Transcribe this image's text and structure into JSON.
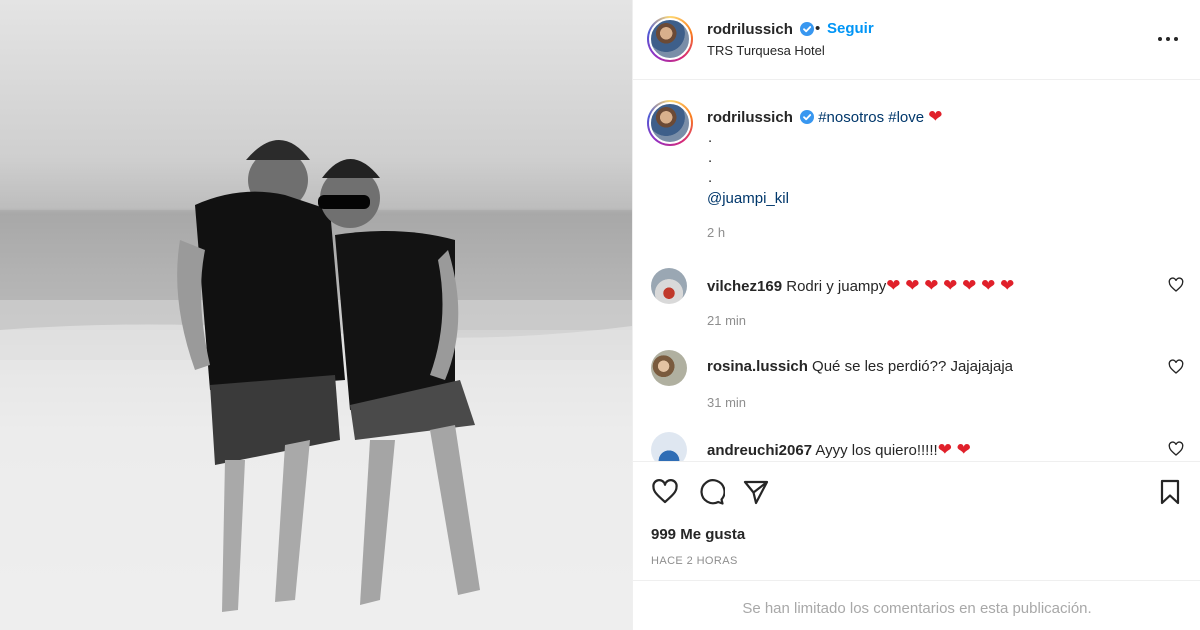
{
  "post": {
    "username": "rodrilussich",
    "follow_label": "Seguir",
    "separator": "•",
    "location": "TRS Turquesa Hotel"
  },
  "caption": {
    "username": "rodrilussich",
    "hashtags": [
      "#nosotros",
      "#love"
    ],
    "heart": "❤",
    "dot_lines": [
      ".",
      ".",
      "."
    ],
    "mention": "@juampi_kil",
    "time": "2 h"
  },
  "comments": [
    {
      "username": "vilchez169",
      "text": "Rodri y juampy",
      "hearts": "❤ ❤ ❤ ❤ ❤ ❤ ❤",
      "time": "21 min"
    },
    {
      "username": "rosina.lussich",
      "text": "Qué se les perdió?? Jajajajaja",
      "hearts": "",
      "time": "31 min"
    },
    {
      "username": "andreuchi2067",
      "text": "Ayyy los quiero!!!!!",
      "hearts": "❤ ❤",
      "time": ""
    }
  ],
  "actions": {
    "likes": "999 Me gusta",
    "posted_ago": "HACE 2 HORAS",
    "comments_limited": "Se han limitado los comentarios en esta publicación."
  },
  "icons": {
    "verified": "verified-badge-icon",
    "more": "more-options-icon",
    "like": "heart-outline-icon",
    "comment": "comment-bubble-icon",
    "share": "paper-plane-icon",
    "save": "bookmark-icon"
  },
  "colors": {
    "accent_blue": "#0095f6",
    "link_blue": "#00376b",
    "verified_blue": "#3897f0",
    "heart_red": "#e0202a",
    "muted": "#8e8e8e"
  }
}
